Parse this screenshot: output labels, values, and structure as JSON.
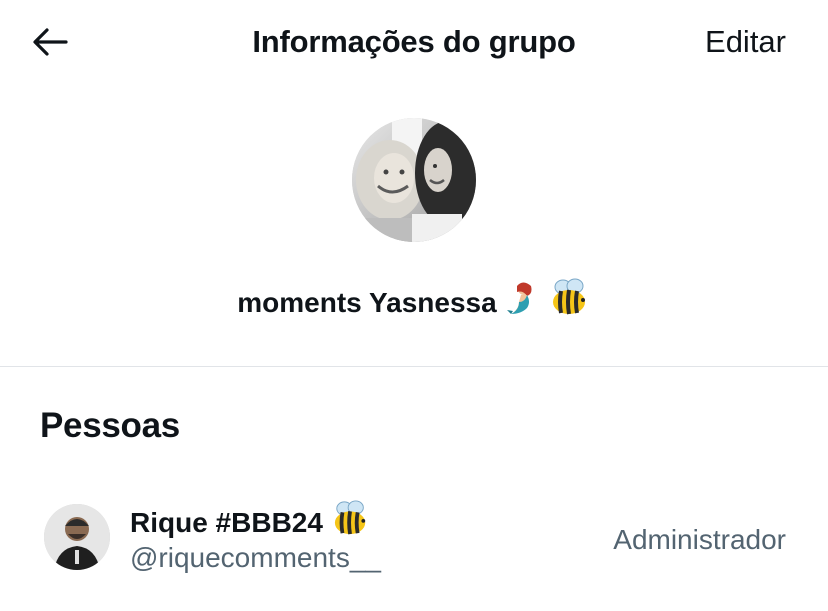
{
  "header": {
    "title": "Informações do grupo",
    "edit_label": "Editar"
  },
  "group": {
    "name": "moments Yasnessa"
  },
  "people": {
    "section_title": "Pessoas",
    "members": [
      {
        "name": "Rique #BBB24",
        "handle": "@riquecomments__",
        "role": "Administrador"
      }
    ]
  },
  "icons": {
    "back": "arrow-left-icon",
    "mermaid": "mermaid-emoji-icon",
    "bee": "bee-emoji-icon"
  }
}
